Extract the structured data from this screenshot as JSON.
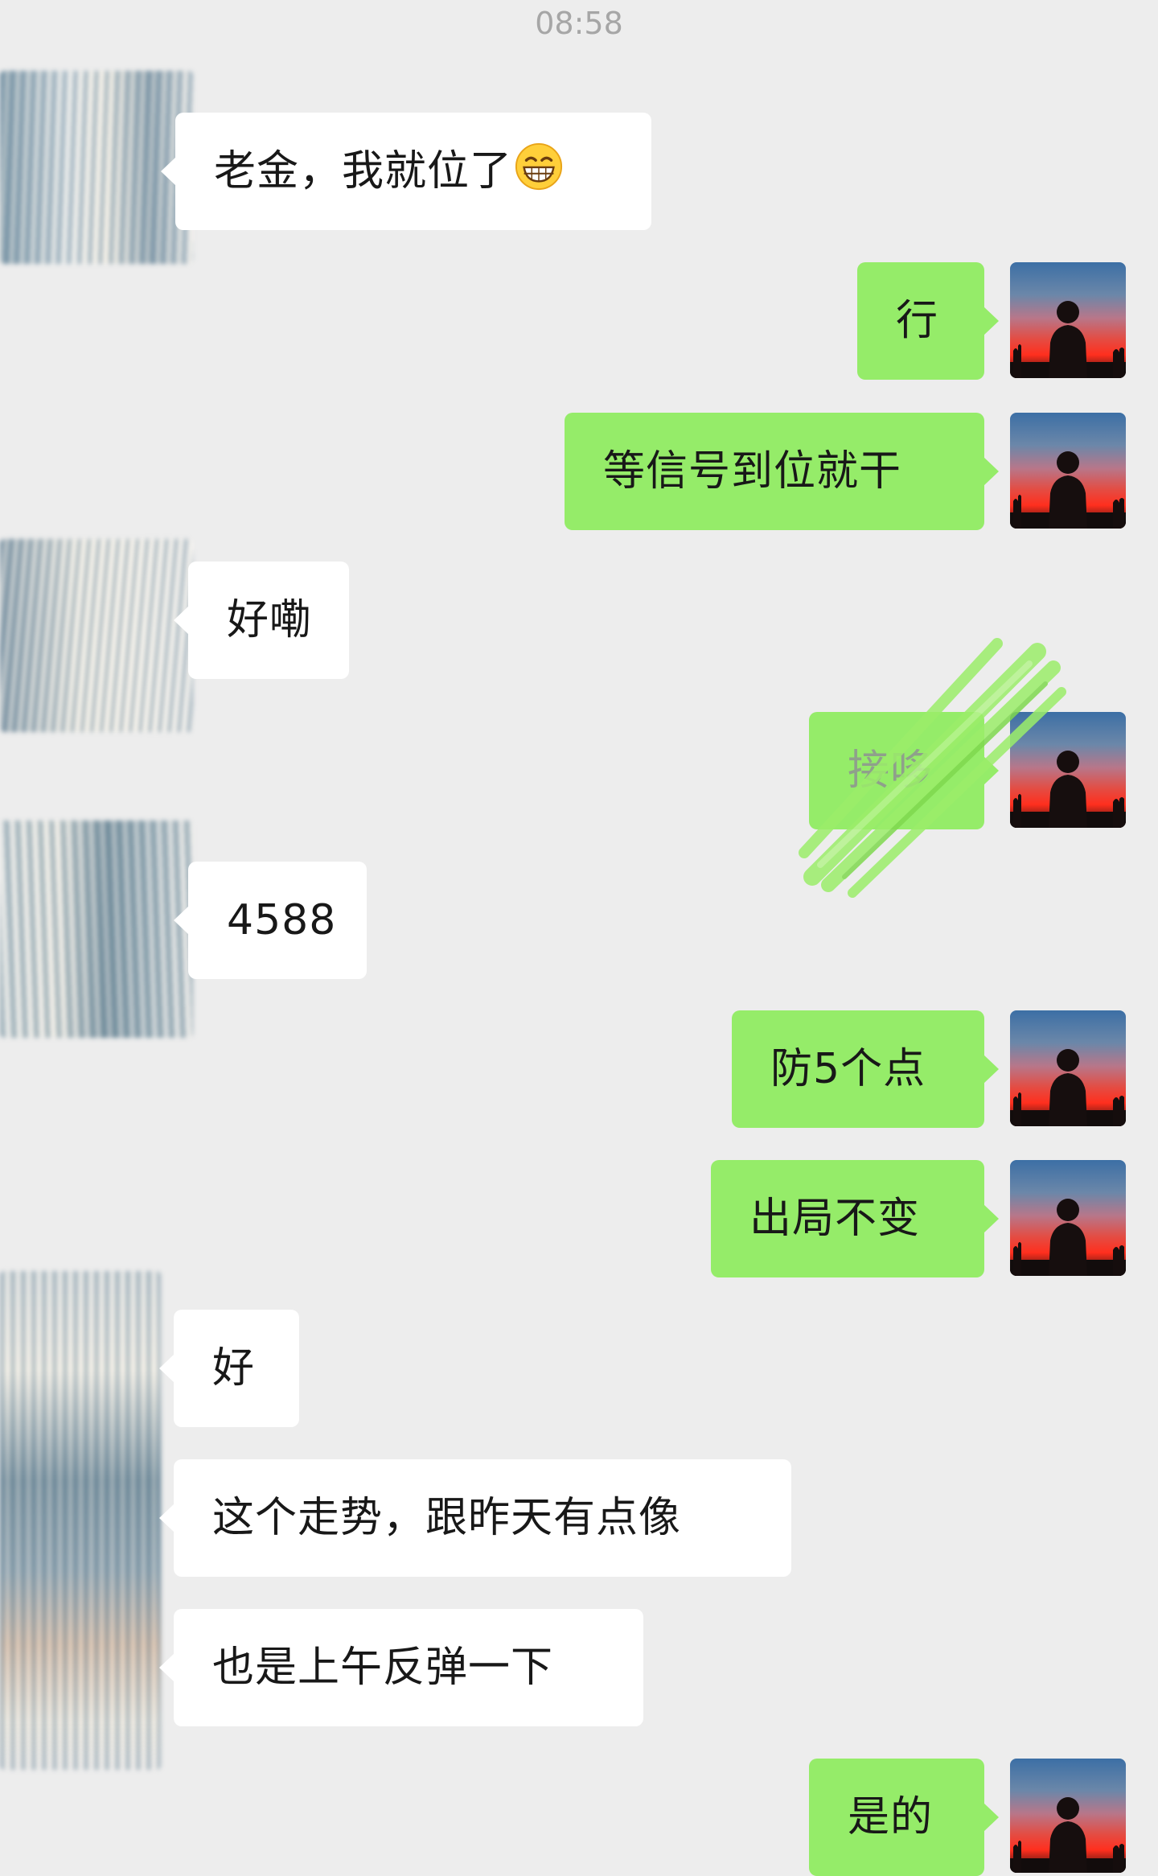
{
  "status": {
    "time": "08:58"
  },
  "colors": {
    "background": "#ededed",
    "incoming_bubble": "#ffffff",
    "outgoing_bubble": "#95ec69",
    "timestamp_text": "#a6a6a6"
  },
  "messages": [
    {
      "direction": "in",
      "text": "老金，我就位了",
      "emoji": "grinning-face-emoji"
    },
    {
      "direction": "out",
      "text": "行"
    },
    {
      "direction": "out",
      "text": "等信号到位就干"
    },
    {
      "direction": "in",
      "text": "好嘞"
    },
    {
      "direction": "out",
      "text": "接哆"
    },
    {
      "direction": "in",
      "text": "4588"
    },
    {
      "direction": "out",
      "text": "防5个点"
    },
    {
      "direction": "out",
      "text": "出局不变"
    },
    {
      "direction": "in",
      "text": "好"
    },
    {
      "direction": "in",
      "text": "这个走势，跟昨天有点像"
    },
    {
      "direction": "in",
      "text": "也是上午反弹一下"
    },
    {
      "direction": "out",
      "text": "是的"
    }
  ]
}
